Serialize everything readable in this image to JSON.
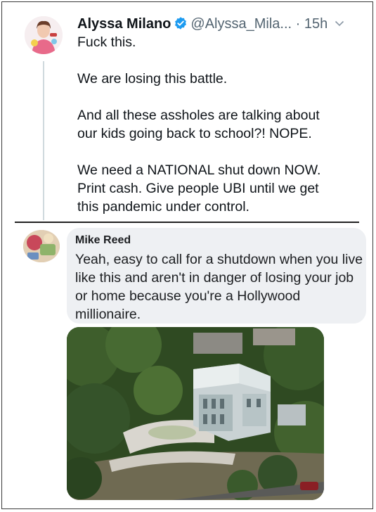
{
  "tweet": {
    "display_name": "Alyssa Milano",
    "handle": "@Alyssa_Mila...",
    "separator": "·",
    "time": "15h",
    "paragraphs": [
      "Fuck this.",
      "We are losing this battle.",
      "And all these assholes are talking about\nour kids going back to school?! NOPE.",
      "We need a NATIONAL shut down NOW.\nPrint cash. Give people UBI until we get\nthis pandemic under control."
    ],
    "icons": {
      "verified": "verified-badge-icon",
      "menu": "chevron-down-icon"
    },
    "colors": {
      "verified_blue": "#1d9bf0",
      "secondary_text": "#536471"
    }
  },
  "comment": {
    "author": "Mike Reed",
    "text": "Yeah, easy to call for a shutdown when you live like this and aren't in danger of losing your job or home because you're a Hollywood millionaire.",
    "bubble_color": "#eef0f3"
  }
}
